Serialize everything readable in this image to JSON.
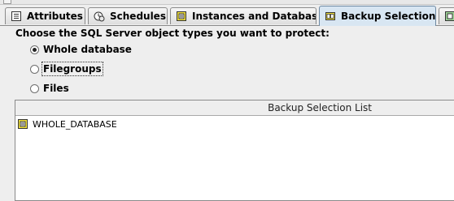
{
  "tabs": [
    {
      "label": "Attributes",
      "icon": "list-icon",
      "active": false
    },
    {
      "label": "Schedules",
      "icon": "clock-icon",
      "active": false
    },
    {
      "label": "Instances and Databases",
      "icon": "database-icon",
      "active": false
    },
    {
      "label": "Backup Selections",
      "icon": "backup-selection-icon",
      "active": true
    }
  ],
  "content": {
    "heading": "Choose the SQL Server object types you want to protect:",
    "options": [
      {
        "label": "Whole database",
        "checked": true
      },
      {
        "label": "Filegroups",
        "checked": false
      },
      {
        "label": "Files",
        "checked": false
      }
    ]
  },
  "list": {
    "column": "Backup Selection List",
    "rows": [
      {
        "label": "WHOLE_DATABASE",
        "icon": "database-icon"
      }
    ]
  },
  "colors": {
    "background": "#eeeeee",
    "active_tab": "#d8e6f2",
    "icon_yellow": "#f0e03a"
  }
}
